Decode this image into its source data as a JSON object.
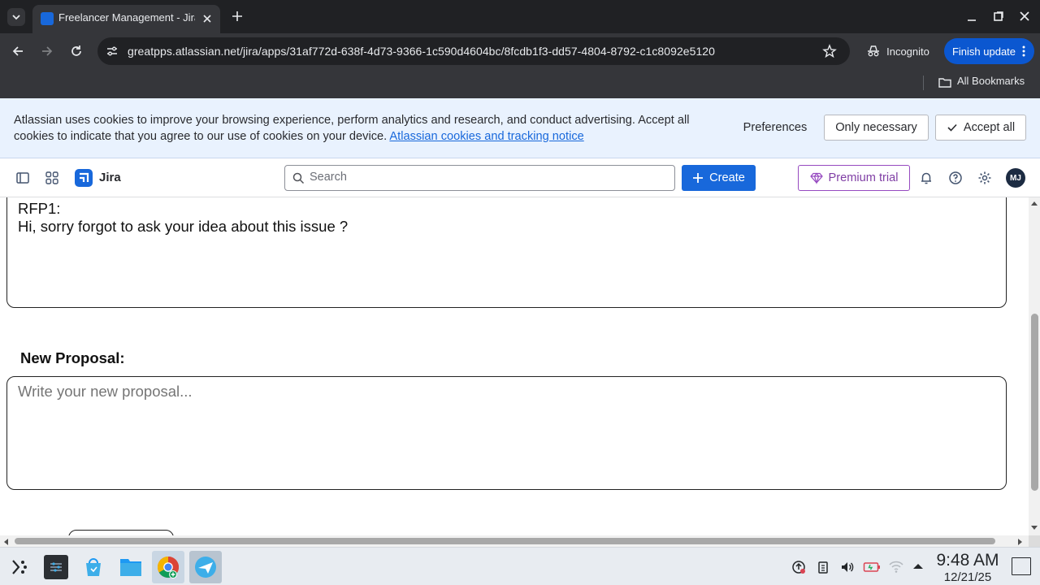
{
  "browser": {
    "tab_title": "Freelancer Management - Jira",
    "url": "greatpps.atlassian.net/jira/apps/31af772d-638f-4d73-9366-1c590d4604bc/8fcdb1f3-dd57-4804-8792-c1c8092e5120",
    "incognito_label": "Incognito",
    "finish_update_label": "Finish update",
    "all_bookmarks_label": "All Bookmarks"
  },
  "cookie_banner": {
    "text": "Atlassian uses cookies to improve your browsing experience, perform analytics and research, and conduct advertising. Accept all cookies to indicate that you agree to our use of cookies on your device.",
    "link_text": "Atlassian cookies and tracking notice",
    "preferences_label": "Preferences",
    "only_necessary_label": "Only necessary",
    "accept_all_label": "Accept all"
  },
  "jira_nav": {
    "app_name": "Jira",
    "search_placeholder": "Search",
    "create_label": "Create",
    "premium_label": "Premium trial",
    "avatar_initials": "MJ"
  },
  "content": {
    "message_sender": "RFP1:",
    "message_text": "Hi, sorry forgot to ask your idea about this issue ?",
    "new_proposal_label": "New Proposal:",
    "proposal_placeholder": "Write your new proposal..."
  },
  "taskbar": {
    "time": "9:48 AM",
    "date": "12/21/25"
  },
  "colors": {
    "jira_blue": "#1868db",
    "chrome_dark": "#202124",
    "cookie_bg": "#e9f2fe",
    "premium_purple": "#964ac0"
  }
}
